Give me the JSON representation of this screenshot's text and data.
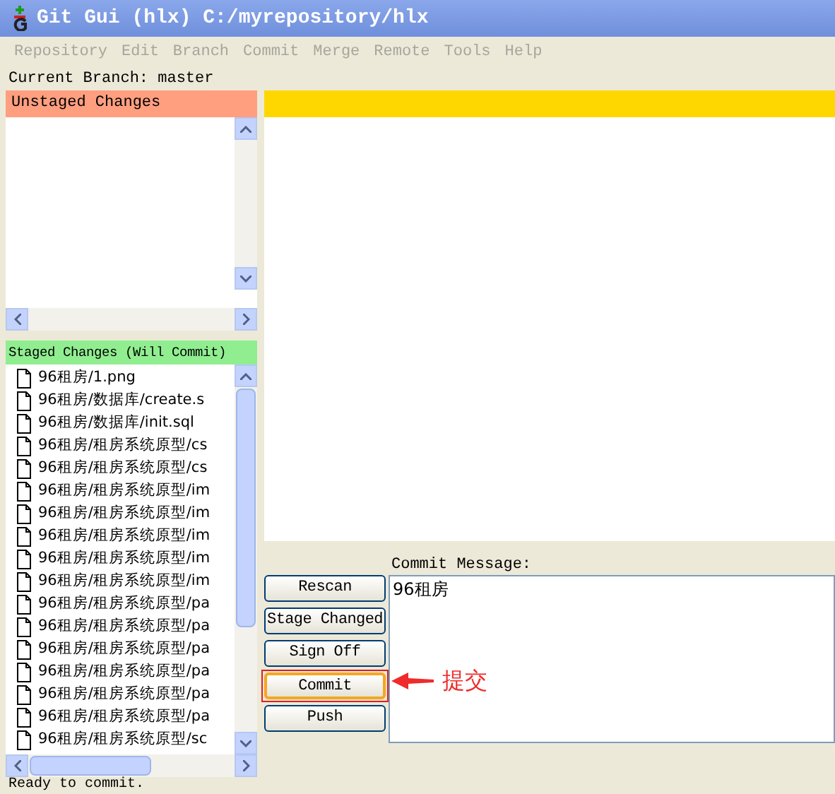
{
  "window": {
    "title": "Git Gui (hlx) C:/myrepository/hlx"
  },
  "menu": [
    "Repository",
    "Edit",
    "Branch",
    "Commit",
    "Merge",
    "Remote",
    "Tools",
    "Help"
  ],
  "current_branch": "Current Branch: master",
  "unstaged": {
    "title": "Unstaged Changes"
  },
  "staged": {
    "title": "Staged Changes (Will Commit)",
    "files": [
      "96租房/1.png",
      "96租房/数据库/create.s",
      "96租房/数据库/init.sql",
      "96租房/租房系统原型/cs",
      "96租房/租房系统原型/cs",
      "96租房/租房系统原型/im",
      "96租房/租房系统原型/im",
      "96租房/租房系统原型/im",
      "96租房/租房系统原型/im",
      "96租房/租房系统原型/im",
      "96租房/租房系统原型/pa",
      "96租房/租房系统原型/pa",
      "96租房/租房系统原型/pa",
      "96租房/租房系统原型/pa",
      "96租房/租房系统原型/pa",
      "96租房/租房系统原型/pa",
      "96租房/租房系统原型/sc"
    ]
  },
  "commit_message": {
    "label": "Commit Message:",
    "value": "96租房"
  },
  "buttons": [
    {
      "label": "Rescan",
      "focused": false
    },
    {
      "label": "Stage Changed",
      "focused": false
    },
    {
      "label": "Sign Off",
      "focused": false
    },
    {
      "label": "Commit",
      "focused": true
    },
    {
      "label": "Push",
      "focused": false
    }
  ],
  "annotation": {
    "text": "提交"
  },
  "status_bar": "Ready to commit."
}
